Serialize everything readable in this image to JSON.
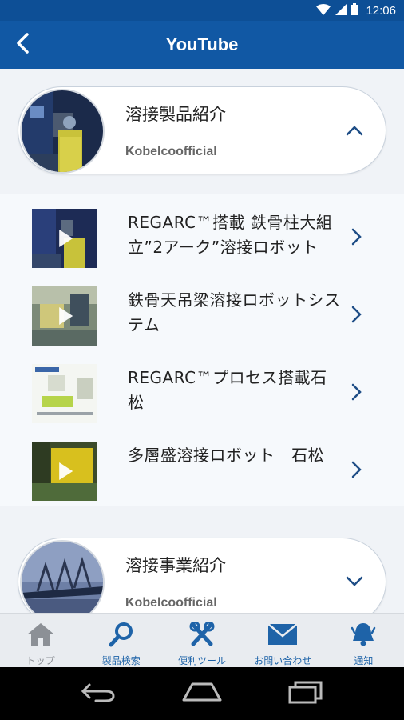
{
  "status_bar": {
    "time": "12:06"
  },
  "app_bar": {
    "title": "YouTube"
  },
  "channels": [
    {
      "name": "溶接製品紹介",
      "owner": "Kobelcoofficial",
      "expanded": true
    },
    {
      "name": "溶接事業紹介",
      "owner": "Kobelcoofficial",
      "expanded": false
    }
  ],
  "videos": [
    {
      "title": "REGARC™搭載 鉄骨柱大組立”2アーク”溶接ロボット"
    },
    {
      "title": "鉄骨天吊梁溶接ロボットシステム"
    },
    {
      "title": "REGARC™プロセス搭載石松"
    },
    {
      "title": "多層盛溶接ロボット　石松"
    }
  ],
  "bottom_nav": {
    "items": [
      {
        "label": "トップ",
        "icon": "home-icon",
        "active": false
      },
      {
        "label": "製品検索",
        "icon": "search-icon",
        "active": true
      },
      {
        "label": "便利ツール",
        "icon": "tools-icon",
        "active": true
      },
      {
        "label": "お問い合わせ",
        "icon": "mail-icon",
        "active": true
      },
      {
        "label": "通知",
        "icon": "bell-icon",
        "active": true
      }
    ]
  },
  "colors": {
    "primary": "#1158a4",
    "status_bar": "#0d4f96",
    "accent": "#1e63a8"
  }
}
